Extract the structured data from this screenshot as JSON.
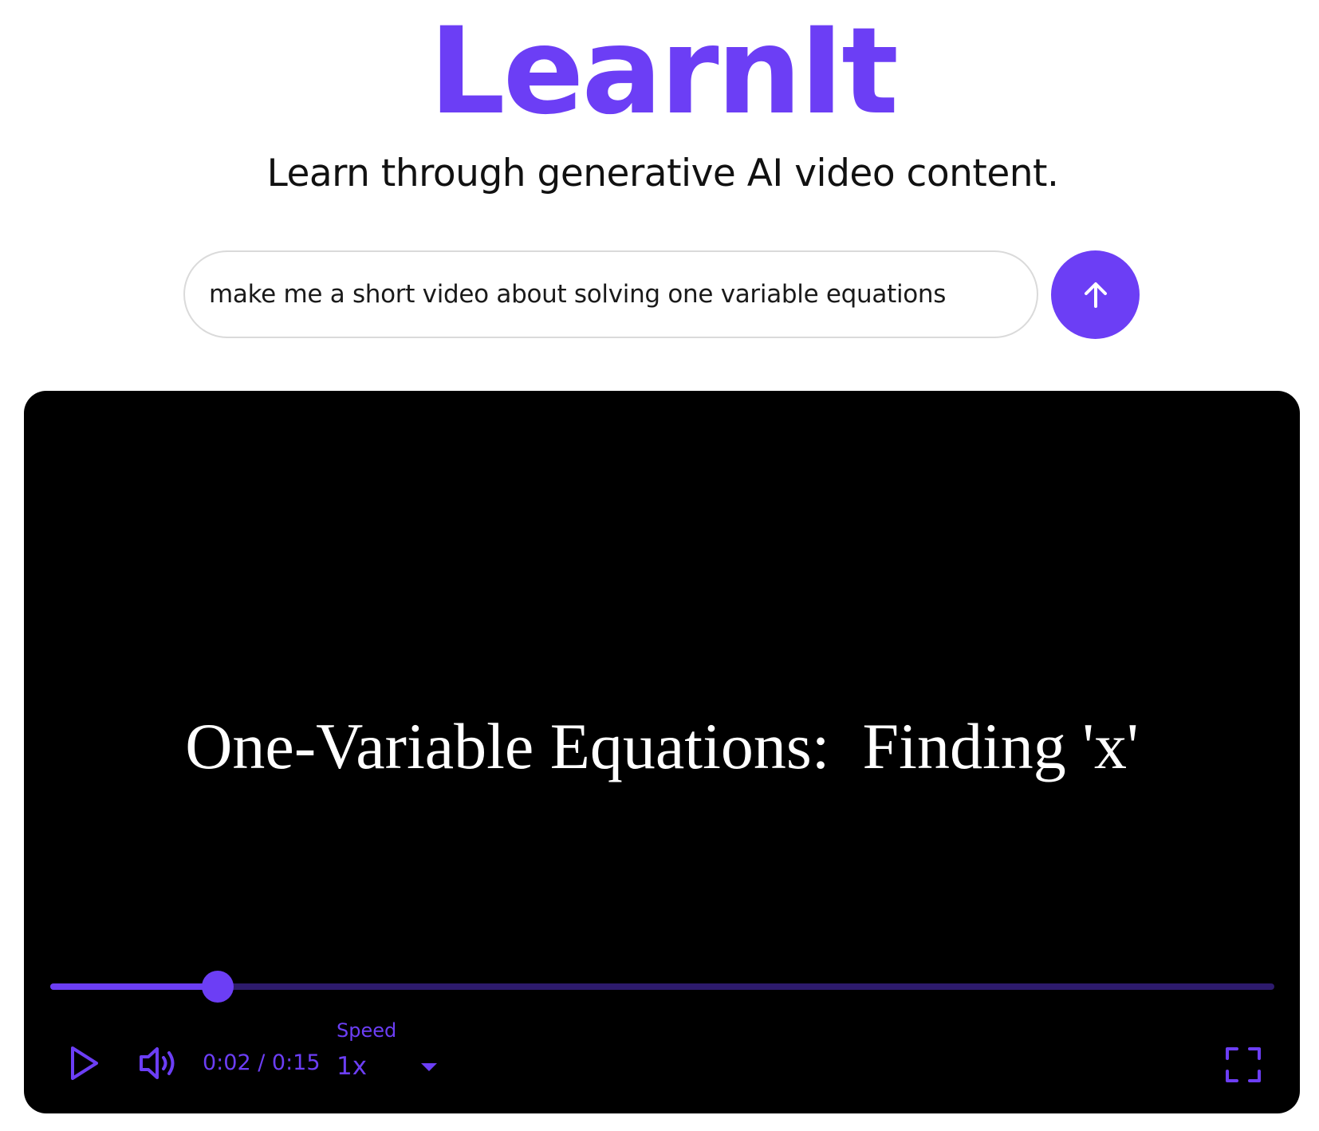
{
  "app": {
    "title": "LearnIt",
    "tagline": "Learn through generative AI video content."
  },
  "prompt": {
    "value": "make me a short video about solving one variable equations",
    "submit_icon": "arrow-up-icon"
  },
  "player": {
    "video_title": "One-Variable Equations:  Finding 'x'",
    "current_time": "0:02",
    "duration": "0:15",
    "time_display": "0:02 / 0:15",
    "progress_fraction": 0.137,
    "speed_label": "Speed",
    "speed_value": "1x",
    "icons": {
      "play": "play-icon",
      "volume": "volume-icon",
      "speed_dropdown": "caret-down-icon",
      "fullscreen": "fullscreen-icon"
    }
  },
  "colors": {
    "accent": "#6c3ef5",
    "track": "#2e1b6d",
    "video_background": "#000000",
    "video_text": "#ffffff"
  }
}
